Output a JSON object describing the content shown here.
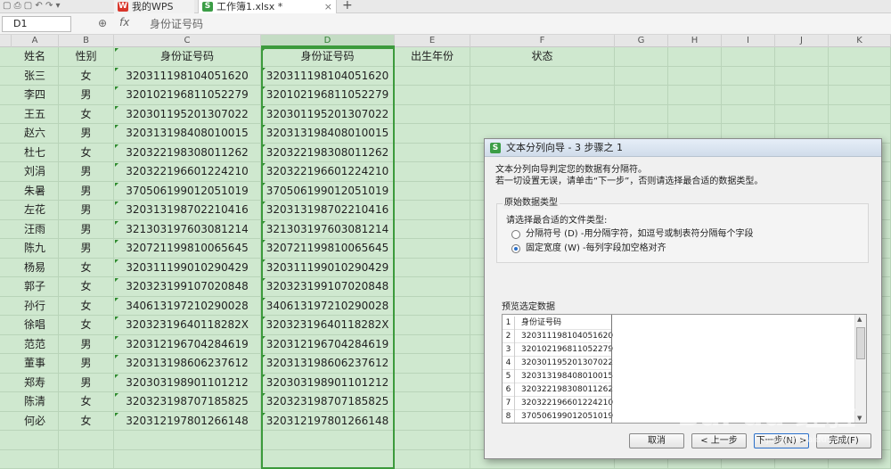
{
  "tabs": [
    {
      "label": "我的WPS",
      "icon": "wps-logo-icon"
    },
    {
      "label": "工作簿1.xlsx *",
      "icon": "sheet-logo-icon"
    }
  ],
  "formula_bar": {
    "name_box": "D1",
    "fx": "fx",
    "value": "身份证号码"
  },
  "columns": [
    "A",
    "B",
    "C",
    "D",
    "E",
    "F",
    "G",
    "H",
    "I",
    "J",
    "K"
  ],
  "headers": {
    "name": "姓名",
    "gender": "性别",
    "id1": "身份证号码",
    "id2": "身份证号码",
    "birth": "出生年份",
    "status": "状态"
  },
  "rows": [
    {
      "name": "张三",
      "gender": "女",
      "id": "320311198104051620"
    },
    {
      "name": "李四",
      "gender": "男",
      "id": "320102196811052279"
    },
    {
      "name": "王五",
      "gender": "女",
      "id": "320301195201307022"
    },
    {
      "name": "赵六",
      "gender": "男",
      "id": "320313198408010015"
    },
    {
      "name": "杜七",
      "gender": "女",
      "id": "320322198308011262"
    },
    {
      "name": "刘涓",
      "gender": "男",
      "id": "320322196601224210"
    },
    {
      "name": "朱暑",
      "gender": "男",
      "id": "370506199012051019"
    },
    {
      "name": "左花",
      "gender": "男",
      "id": "320313198702210416"
    },
    {
      "name": "汪雨",
      "gender": "男",
      "id": "321303197603081214"
    },
    {
      "name": "陈九",
      "gender": "男",
      "id": "320721199810065645"
    },
    {
      "name": "杨易",
      "gender": "女",
      "id": "320311199010290429"
    },
    {
      "name": "郭子",
      "gender": "女",
      "id": "320323199107020848"
    },
    {
      "name": "孙行",
      "gender": "女",
      "id": "340613197210290028"
    },
    {
      "name": "徐唱",
      "gender": "女",
      "id": "32032319640118282X"
    },
    {
      "name": "范范",
      "gender": "男",
      "id": "320312196704284619"
    },
    {
      "name": "董事",
      "gender": "男",
      "id": "320313198606237612"
    },
    {
      "name": "郑寿",
      "gender": "男",
      "id": "320303198901101212"
    },
    {
      "name": "陈清",
      "gender": "女",
      "id": "320323198707185825"
    },
    {
      "name": "何必",
      "gender": "女",
      "id": "320312197801266148"
    }
  ],
  "dialog": {
    "title": "文本分列向导 - 3 步骤之 1",
    "intro1": "文本分列向导判定您的数据有分隔符。",
    "intro2": "若一切设置无误，请单击“下一步”，否则请选择最合适的数据类型。",
    "group_label": "原始数据类型",
    "choose_label": "请选择最合适的文件类型:",
    "option1": "分隔符号 (D)  -用分隔字符，如逗号或制表符分隔每个字段",
    "option2": "固定宽度 (W)  -每列字段加空格对齐",
    "selected_option": "固定宽度",
    "preview_label": "预览选定数据",
    "preview_rows": [
      {
        "n": "1",
        "t": "身份证号码"
      },
      {
        "n": "2",
        "t": "320311198104051620"
      },
      {
        "n": "3",
        "t": "320102196811052279"
      },
      {
        "n": "4",
        "t": "320301195201307022"
      },
      {
        "n": "5",
        "t": "320313198408010015"
      },
      {
        "n": "6",
        "t": "320322198308011262"
      },
      {
        "n": "7",
        "t": "320322196601224210"
      },
      {
        "n": "8",
        "t": "370506199012051019"
      }
    ],
    "buttons": {
      "cancel": "取消",
      "back": "< 上一步",
      "next": "下一步(N) >",
      "finish": "完成(F)"
    }
  },
  "watermark": {
    "main": "Bai du 经验",
    "sub": "jingyan.baidu.com"
  },
  "colors": {
    "sheet_bg": "#cfe8cf",
    "selection": "#3c9a3c",
    "grid_line": "#b9d4b9"
  }
}
